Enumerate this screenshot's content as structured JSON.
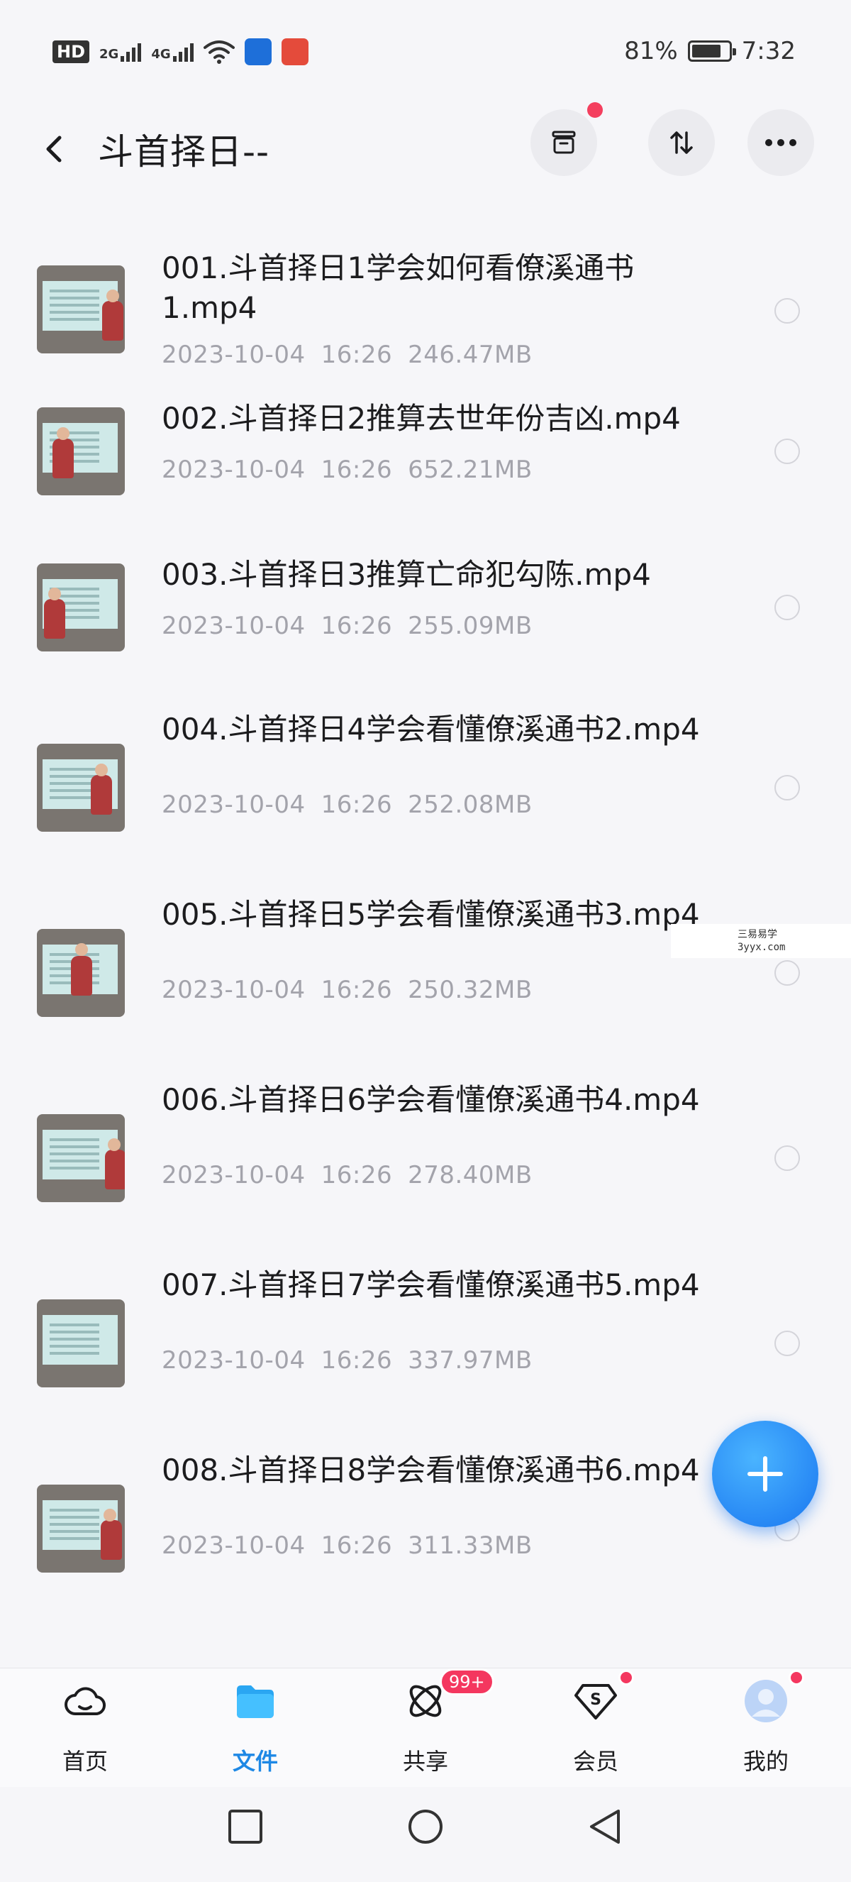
{
  "status_bar": {
    "network_hd": "HD",
    "network_2g": "2G",
    "network_4g": "4G",
    "battery": "81%",
    "battery_level": 0.81,
    "time": "7:32"
  },
  "header": {
    "title": "斗首择日--",
    "icons": [
      "back-icon",
      "archive-icon",
      "sort-icon",
      "more-icon"
    ]
  },
  "files": [
    {
      "name": "001.斗首择日1学会如何看僚溪通书1.mp4",
      "date": "2023-10-04",
      "time": "16:26",
      "size": "246.47MB"
    },
    {
      "name": "002.斗首择日2推算去世年份吉凶.mp4",
      "date": "2023-10-04",
      "time": "16:26",
      "size": "652.21MB"
    },
    {
      "name": "003.斗首择日3推算亡命犯勾陈.mp4",
      "date": "2023-10-04",
      "time": "16:26",
      "size": "255.09MB"
    },
    {
      "name": "004.斗首择日4学会看懂僚溪通书2.mp4",
      "date": "2023-10-04",
      "time": "16:26",
      "size": "252.08MB"
    },
    {
      "name": "005.斗首择日5学会看懂僚溪通书3.mp4",
      "date": "2023-10-04",
      "time": "16:26",
      "size": "250.32MB"
    },
    {
      "name": "006.斗首择日6学会看懂僚溪通书4.mp4",
      "date": "2023-10-04",
      "time": "16:26",
      "size": "278.40MB"
    },
    {
      "name": "007.斗首择日7学会看懂僚溪通书5.mp4",
      "date": "2023-10-04",
      "time": "16:26",
      "size": "337.97MB"
    },
    {
      "name": "008.斗首择日8学会看懂僚溪通书6.mp4",
      "date": "2023-10-04",
      "time": "16:26",
      "size": "311.33MB"
    }
  ],
  "watermark": {
    "line1": "三易易学",
    "line2": "3yyx.com"
  },
  "tabs": [
    {
      "label": "首页",
      "icon": "cloud-icon"
    },
    {
      "label": "文件",
      "icon": "folder-icon",
      "active": true
    },
    {
      "label": "共享",
      "icon": "share-icon",
      "badge": "99+"
    },
    {
      "label": "会员",
      "icon": "vip-icon"
    },
    {
      "label": "我的",
      "icon": "avatar-icon"
    }
  ],
  "colors": {
    "accent": "#1e88e5",
    "badge": "#f4375f",
    "background": "#f6f6f9",
    "meta_text": "#a3a3ab"
  }
}
